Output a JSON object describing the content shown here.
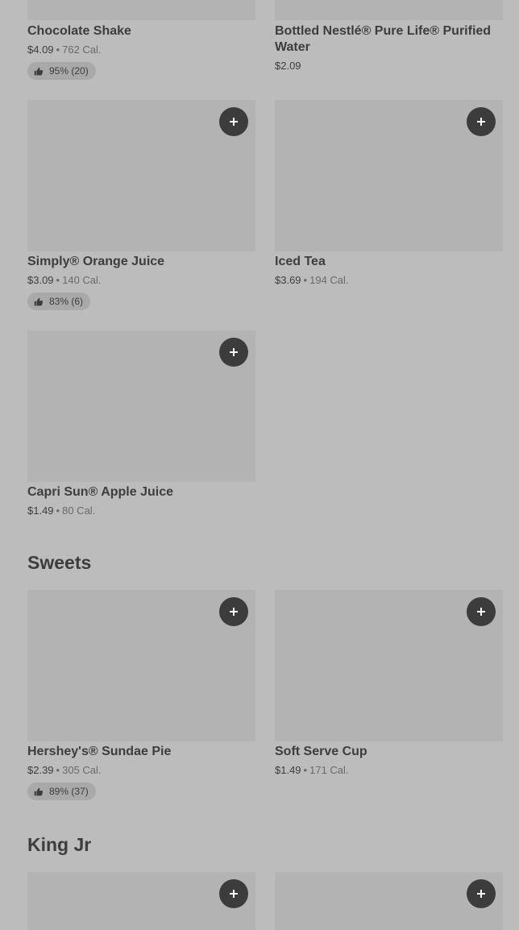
{
  "items": {
    "chocolate_shake": {
      "name": "Chocolate Shake",
      "price": "$4.09",
      "calories": "762 Cal.",
      "rating": "95% (20)"
    },
    "bottled_water": {
      "name": "Bottled Nestlé® Pure Life® Purified Water",
      "price": "$2.09"
    },
    "orange_juice": {
      "name": "Simply® Orange Juice",
      "price": "$3.09",
      "calories": "140 Cal.",
      "rating": "83% (6)"
    },
    "iced_tea": {
      "name": "Iced Tea",
      "price": "$3.69",
      "calories": "194 Cal."
    },
    "capri_sun": {
      "name": "Capri Sun® Apple Juice",
      "price": "$1.49",
      "calories": "80 Cal."
    },
    "sundae_pie": {
      "name": "Hershey's® Sundae Pie",
      "price": "$2.39",
      "calories": "305 Cal.",
      "rating": "89% (37)"
    },
    "soft_serve": {
      "name": "Soft Serve Cup",
      "price": "$1.49",
      "calories": "171 Cal."
    }
  },
  "sections": {
    "sweets": "Sweets",
    "king_jr": "King Jr"
  },
  "separator": "•",
  "icons": {
    "add": "plus-icon",
    "rating": "thumbs-up-icon"
  },
  "colors": {
    "background": "#bcbcbc",
    "image_placeholder": "#b3b3b3",
    "button": "#3c3c3c",
    "badge": "#a9a9a9"
  }
}
